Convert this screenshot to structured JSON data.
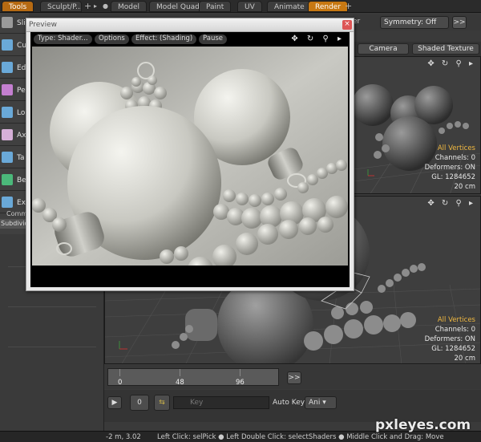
{
  "tabs": {
    "tools": "Tools",
    "sculpt": "Sculpt/P...",
    "plus1": "+",
    "model": "Model",
    "model_quad": "Model Quad",
    "paint": "Paint",
    "uv": "UV",
    "animate": "Animate",
    "render": "Render",
    "plus2": "+"
  },
  "left_tools": [
    {
      "label": "Sli",
      "color": "#9a9a9a"
    },
    {
      "label": "Cu",
      "color": "#6aa9d8"
    },
    {
      "label": "Ed",
      "color": "#6aa9d8"
    },
    {
      "label": "Pe",
      "color": "#c47fd0"
    },
    {
      "label": "Lo",
      "color": "#6aa9d8"
    },
    {
      "label": "Ax",
      "color": "#d6b0d8"
    },
    {
      "label": "Ta",
      "color": "#6aa9d8"
    },
    {
      "label": "Be",
      "color": "#4bb87a"
    },
    {
      "label": "Ex",
      "color": "#6aa9d8"
    }
  ],
  "left_extra": {
    "line1": "Comm",
    "line2": "Subdivide"
  },
  "right_toolbar": {
    "partial": "er",
    "symmetry": "Symmetry: Off",
    "arrow": ">>"
  },
  "viewport_tabs": {
    "camera": "Camera",
    "shaded_texture": "Shaded Texture"
  },
  "viewport_top": {
    "icons": "✥ ↻ ⚲ ▸",
    "stats": {
      "selection": "All Vertices",
      "channels": "Channels: 0",
      "deformers": "Deformers: ON",
      "gl": "GL: 1284652",
      "size": "20 cm"
    }
  },
  "viewport_bottom": {
    "icons": "✥ ↻ ⚲ ▸",
    "stats": {
      "selection": "All Vertices",
      "channels": "Channels: 0",
      "deformers": "Deformers: ON",
      "gl": "GL: 1284652",
      "size": "20 cm"
    }
  },
  "timeline": {
    "ticks": [
      "0",
      "48",
      "96"
    ],
    "arrow": ">>"
  },
  "transport": {
    "play": "▶",
    "frame": "0",
    "key_placeholder": "Key",
    "auto_key": "Auto Key",
    "auto_key_value": "Ani ▾"
  },
  "status": {
    "coords": "-2 m, 3.02",
    "hint": "Left Click: selPick ● Left Double Click: selectShaders ● Middle Click and Drag: Move"
  },
  "watermark": "pxleyes.com",
  "preview": {
    "title": "Preview",
    "close": "×",
    "buttons": {
      "type": "Type: Shader...",
      "options": "Options",
      "effect": "Effect: (Shading)",
      "pause": "Pause"
    },
    "icons": "✥ ↻ ⚲ ▸"
  },
  "colors": {
    "accent": "#c77812",
    "stat_highlight": "#f0b840"
  }
}
